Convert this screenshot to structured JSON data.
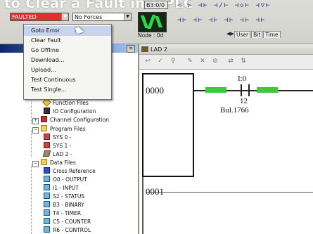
{
  "title_overlay": "to Clear a Fault in a PLC",
  "toolbar": {
    "mode_value": "FAULTED",
    "forces_value": "No Forces",
    "address_field": "B3:0/0",
    "node_label": "Node : 0d",
    "tabs": [
      "User",
      "Bit",
      "Time"
    ]
  },
  "context_menu": {
    "items": [
      "Goto Error",
      "Clear Fault",
      "Go Offline",
      "Download...",
      "Upload...",
      "Test Continuous",
      "Test Single..."
    ],
    "highlighted_index": 0
  },
  "project_tree": {
    "items": [
      {
        "label": "Function Files",
        "icon": "function-files-icon"
      },
      {
        "label": "IO Configuration",
        "icon": "io-config-icon"
      },
      {
        "label": "Channel Configuration",
        "icon": "channel-config-icon"
      },
      {
        "label": "Program Files",
        "icon": "folder-icon"
      },
      {
        "label": "SYS 0 -",
        "icon": "program-file-icon"
      },
      {
        "label": "SYS 1 -",
        "icon": "program-file-icon"
      },
      {
        "label": "LAD 2 -",
        "icon": "ladder-file-icon"
      },
      {
        "label": "Data Files",
        "icon": "folder-icon"
      },
      {
        "label": "Cross Reference",
        "icon": "cross-reference-icon"
      },
      {
        "label": "O0 - OUTPUT",
        "icon": "data-file-icon"
      },
      {
        "label": "I1 - INPUT",
        "icon": "data-file-icon"
      },
      {
        "label": "S2 - STATUS",
        "icon": "data-file-icon"
      },
      {
        "label": "B3 - BINARY",
        "icon": "data-file-icon"
      },
      {
        "label": "T4 - TIMER",
        "icon": "data-file-icon"
      },
      {
        "label": "C5 - COUNTER",
        "icon": "data-file-icon"
      },
      {
        "label": "R6 - CONTROL",
        "icon": "data-file-icon"
      }
    ]
  },
  "ladder": {
    "window_title": "LAD 2",
    "rungs": [
      "0000",
      "0001"
    ],
    "instruction": {
      "address": "I:0",
      "bit": "12",
      "description": "Bul.1766"
    }
  },
  "colors": {
    "faulted_bg": "#e03030",
    "contact_energized": "#3ec83e",
    "menu_highlight": "#c8d3ee"
  }
}
